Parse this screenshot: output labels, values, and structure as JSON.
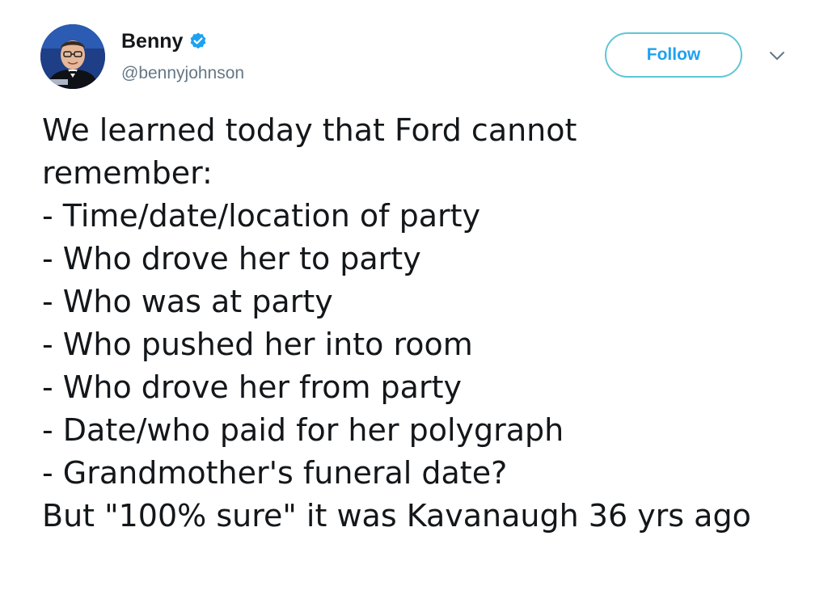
{
  "author": {
    "display_name": "Benny",
    "handle": "@bennyjohnson",
    "verified": true,
    "avatar_icon": "profile-photo"
  },
  "actions": {
    "follow_label": "Follow",
    "menu_icon": "chevron-down-icon"
  },
  "tweet": {
    "lines": [
      "We learned today that Ford cannot",
      "remember:",
      "- Time/date/location of party",
      "- Who drove her to party",
      "- Who was at party",
      "- Who pushed her into room",
      "- Who drove her from party",
      "- Date/who paid for her polygraph",
      "- Grandmother's funeral date?"
    ],
    "closing_line": "But \"100% sure\" it was Kavanaugh 36 yrs ago"
  },
  "colors": {
    "accent": "#1da1f2",
    "follow_border": "#5fc6d6",
    "text": "#14171a",
    "secondary_text": "#657786"
  }
}
